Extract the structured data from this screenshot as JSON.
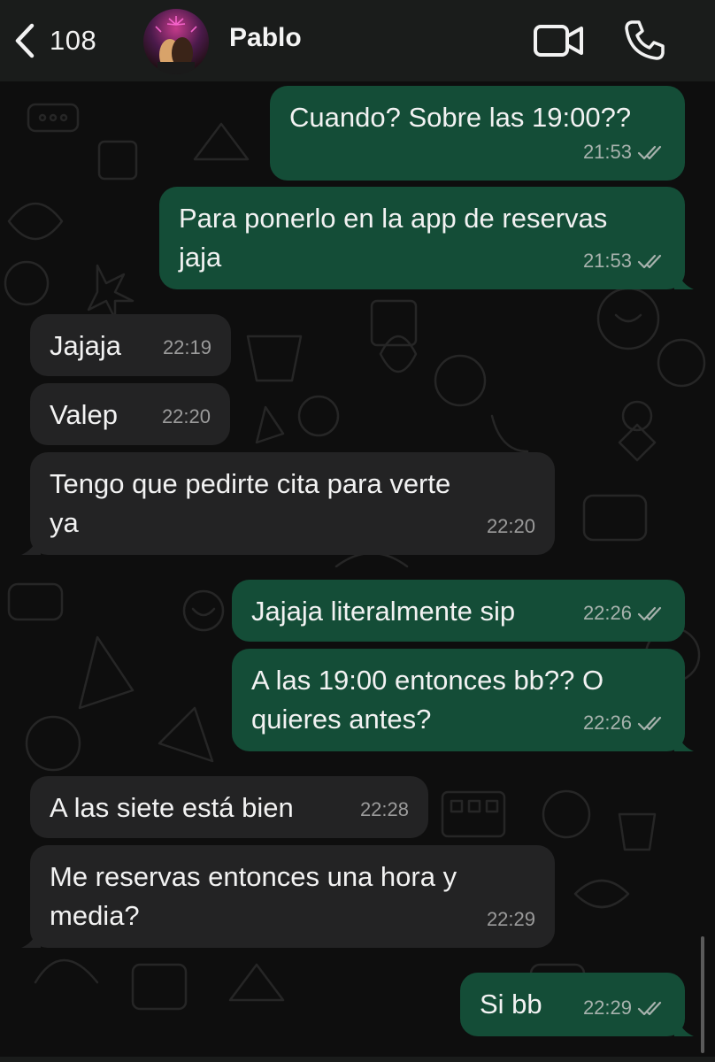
{
  "header": {
    "back_count": "108",
    "contact_name": "Pablo"
  },
  "colors": {
    "outgoing_bubble": "#144d37",
    "incoming_bubble": "#232324",
    "header_bg": "#1a1c1b"
  },
  "messages": [
    {
      "direction": "out",
      "text": "Cuando? Sobre las 19:00??",
      "time": "21:53",
      "status": "read"
    },
    {
      "direction": "out",
      "text": "Para ponerlo en la app de reservas\njaja",
      "time": "21:53",
      "status": "read"
    },
    {
      "direction": "in",
      "text": "Jajaja",
      "time": "22:19"
    },
    {
      "direction": "in",
      "text": "Valep",
      "time": "22:20"
    },
    {
      "direction": "in",
      "text": "Tengo que pedirte cita para verte\nya",
      "time": "22:20"
    },
    {
      "direction": "out",
      "text": "Jajaja literalmente sip",
      "time": "22:26",
      "status": "read"
    },
    {
      "direction": "out",
      "text": "A las 19:00 entonces bb?? O\nquieres antes?",
      "time": "22:26",
      "status": "read"
    },
    {
      "direction": "in",
      "text": "A las siete está bien",
      "time": "22:28"
    },
    {
      "direction": "in",
      "text": "Me reservas entonces una hora y\nmedia?",
      "time": "22:29"
    },
    {
      "direction": "out",
      "text": "Si bb",
      "time": "22:29",
      "status": "read"
    }
  ]
}
